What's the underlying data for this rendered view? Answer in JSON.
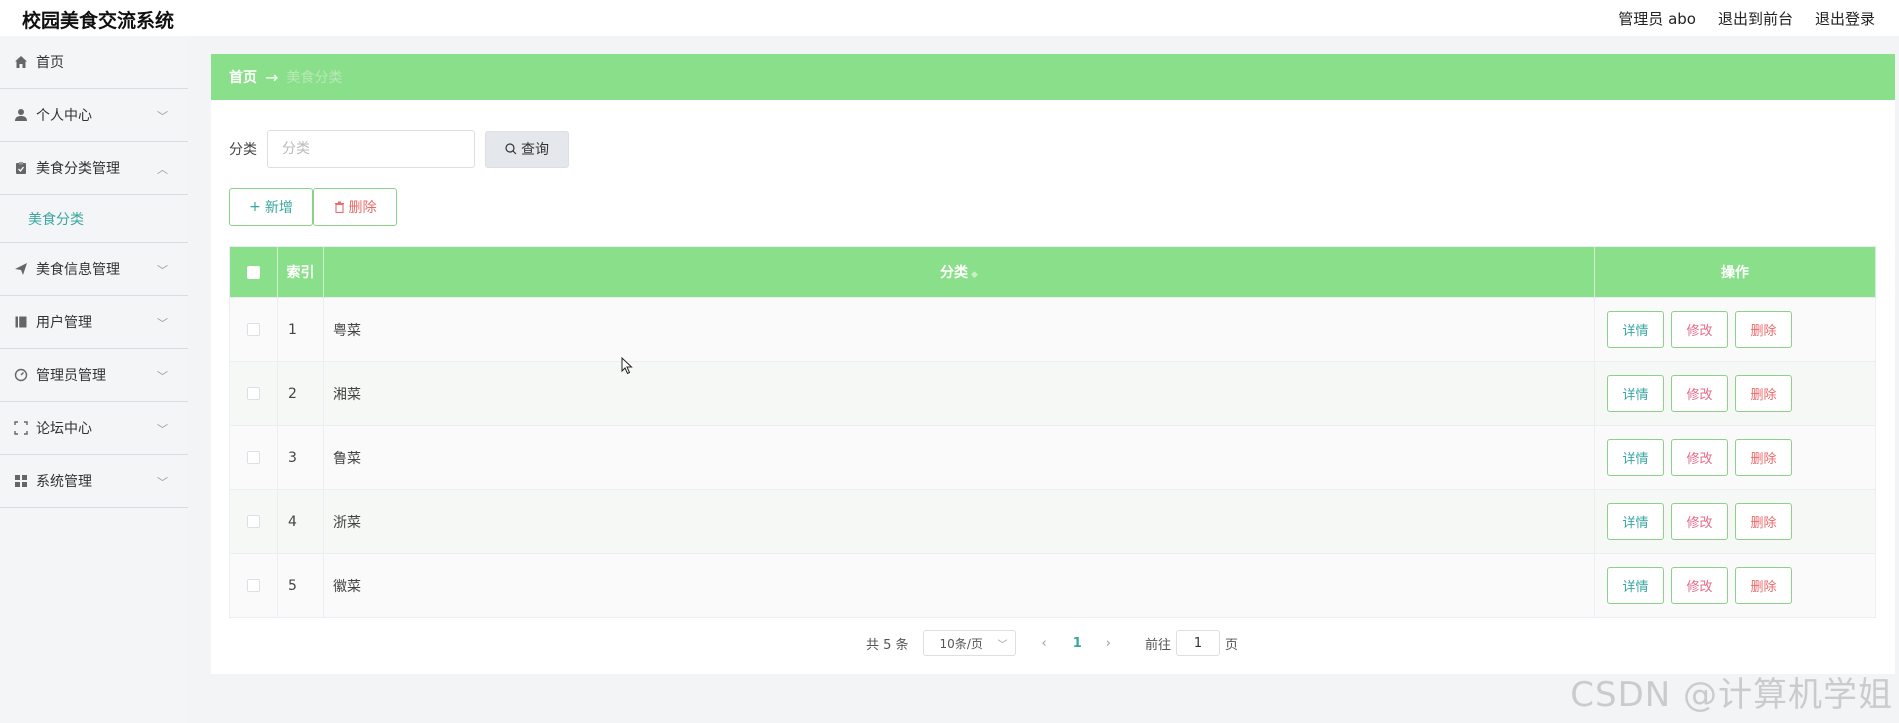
{
  "app": {
    "title": "校园美食交流系统"
  },
  "header": {
    "user": "管理员 abo",
    "to_front": "退出到前台",
    "logout": "退出登录"
  },
  "sidebar": {
    "items": [
      {
        "label": "首页",
        "icon": "home-icon"
      },
      {
        "label": "个人中心",
        "icon": "user-icon"
      },
      {
        "label": "美食分类管理",
        "icon": "clipboard-icon",
        "sub": "美食分类"
      },
      {
        "label": "美食信息管理",
        "icon": "send-icon"
      },
      {
        "label": "用户管理",
        "icon": "book-icon"
      },
      {
        "label": "管理员管理",
        "icon": "dashboard-icon"
      },
      {
        "label": "论坛中心",
        "icon": "fullscreen-icon"
      },
      {
        "label": "系统管理",
        "icon": "grid-icon"
      }
    ]
  },
  "breadcrumb": {
    "home": "首页",
    "arrow": "→",
    "current": "美食分类"
  },
  "search": {
    "label": "分类",
    "placeholder": "分类",
    "button": "查询"
  },
  "actions": {
    "add": "新增",
    "delete": "删除"
  },
  "table": {
    "headers": {
      "index": "索引",
      "category": "分类",
      "operation": "操作"
    },
    "rows": [
      {
        "index": "1",
        "category": "粤菜"
      },
      {
        "index": "2",
        "category": "湘菜"
      },
      {
        "index": "3",
        "category": "鲁菜"
      },
      {
        "index": "4",
        "category": "浙菜"
      },
      {
        "index": "5",
        "category": "徽菜"
      }
    ],
    "row_actions": {
      "detail": "详情",
      "edit": "修改",
      "delete": "删除"
    }
  },
  "pagination": {
    "total": "共 5 条",
    "page_size": "10条/页",
    "current": "1",
    "goto": "前往",
    "page_value": "1",
    "unit": "页"
  },
  "watermark": "CSDN @计算机学姐",
  "colors": {
    "accent_green": "#8ae08a",
    "teal": "#3aa6a0",
    "red": "#e86a6a"
  }
}
